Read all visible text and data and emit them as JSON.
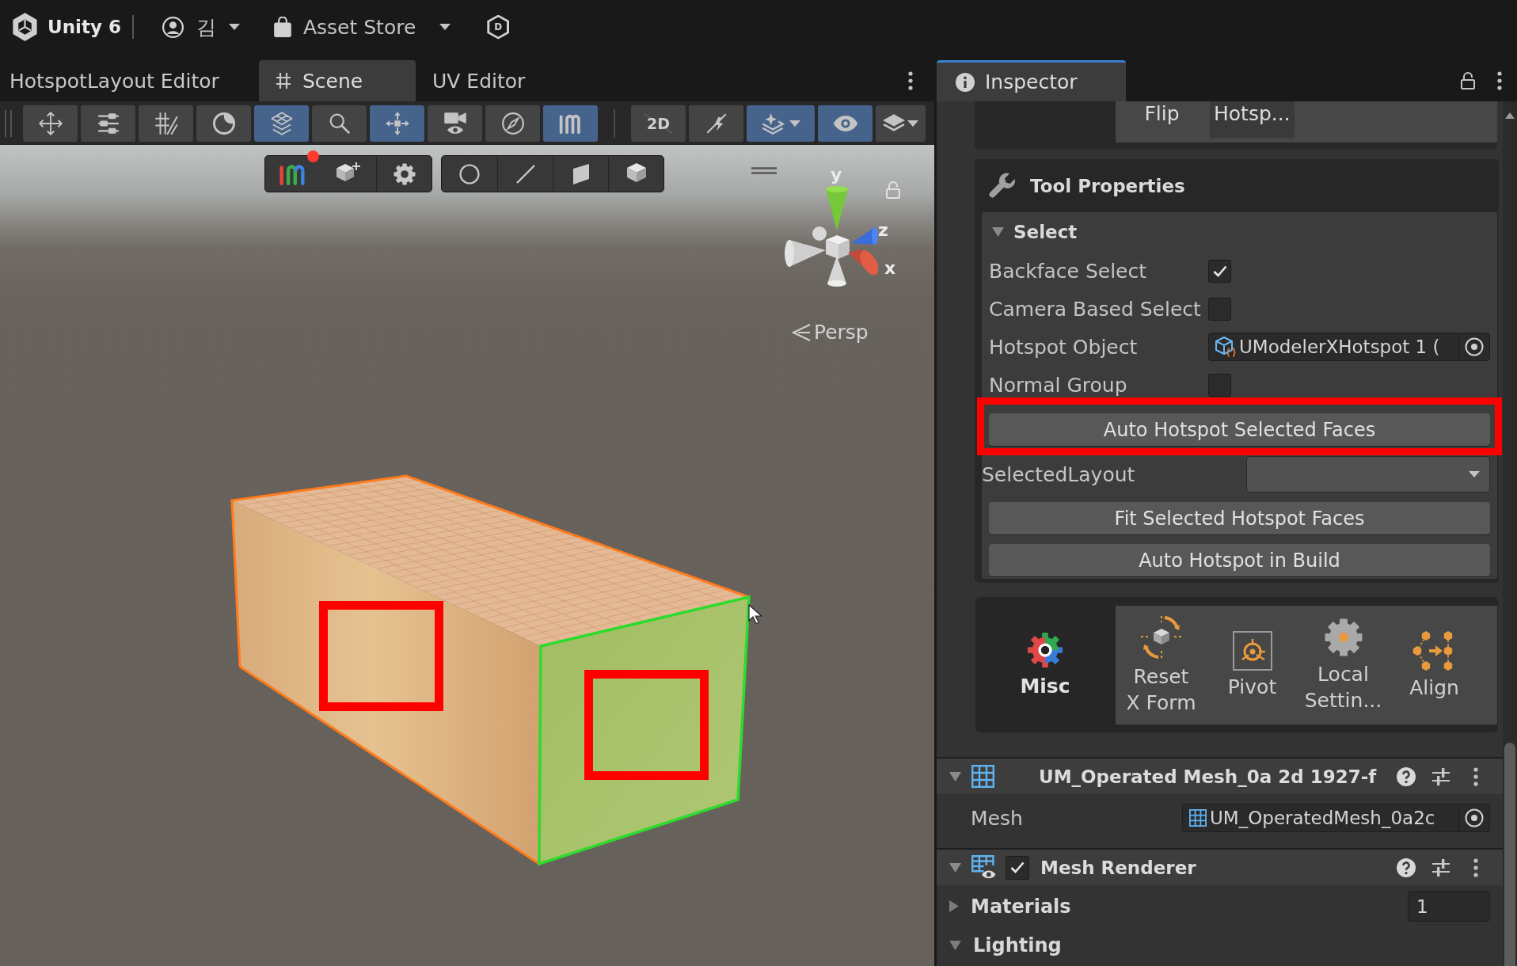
{
  "title_bar": {
    "app_name": "Unity 6",
    "account": "김",
    "store": "Asset Store",
    "badge": "D"
  },
  "scene_panel": {
    "tabs": [
      {
        "kind": "editor",
        "label": "HotspotLayout Editor",
        "selected": false
      },
      {
        "kind": "scene",
        "label": "Scene",
        "selected": true
      },
      {
        "kind": "editor",
        "label": "UV Editor",
        "selected": false
      }
    ],
    "toolbar": [
      {
        "on": false
      },
      {
        "on": false
      },
      {
        "on": false
      },
      {
        "on": false
      },
      {
        "on": true
      },
      {
        "on": false
      },
      {
        "on": true
      },
      {
        "on": false
      },
      {
        "on": false
      },
      {
        "on": true
      },
      {
        "on": false,
        "label": "2D"
      },
      {
        "on": false
      },
      {
        "on": true
      },
      {
        "on": true
      },
      {
        "on": false
      }
    ],
    "overlay_toolbar": [
      {
        "tools": [
          {
            "badge": true
          },
          {
            "badge": false
          },
          {
            "badge": false
          }
        ]
      },
      {
        "tools": [
          {
            "badge": false
          },
          {
            "badge": false
          },
          {
            "badge": false
          },
          {
            "badge": false
          }
        ]
      }
    ],
    "gizmo": {
      "axes": [
        "y",
        "z",
        "x"
      ],
      "projection": "Persp"
    }
  },
  "inspector": {
    "tab": {
      "label": "Inspector",
      "selected": true
    },
    "tool_tabs": [
      {
        "label": "Flip",
        "selected": false
      },
      {
        "label": "Hotsp...",
        "selected": true
      }
    ],
    "tool_properties": {
      "title": "Tool Properties",
      "section": {
        "label": "Select",
        "expanded": true
      },
      "fields": [
        {
          "kind": "checkbox",
          "label": "Backface Select",
          "checked": true
        },
        {
          "kind": "checkbox",
          "label": "Camera Based Select",
          "checked": false
        },
        {
          "kind": "object",
          "label": "Hotspot Object",
          "value": "UModelerXHotspot 1 ("
        },
        {
          "kind": "checkbox",
          "label": "Normal Group",
          "checked": false
        },
        {
          "kind": "button",
          "label": "Auto Hotspot Selected Faces",
          "highlighted": true
        },
        {
          "kind": "dropdown",
          "label": "SelectedLayout"
        },
        {
          "kind": "button",
          "label": "Fit Selected Hotspot Faces",
          "highlighted": false
        },
        {
          "kind": "button",
          "label": "Auto Hotspot in Build",
          "highlighted": false
        }
      ]
    },
    "tool_palette": {
      "category": "Misc",
      "tools": [
        {
          "label": "Reset X Form"
        },
        {
          "label": "Pivot"
        },
        {
          "label": "Local Settin..."
        },
        {
          "label": "Align"
        }
      ]
    },
    "components": [
      {
        "kind": "mesh_filter",
        "title": "UM_Operated Mesh_0a 2d 1927-f",
        "expanded": true,
        "properties": [
          {
            "kind": "object",
            "label": "Mesh",
            "value": "UM_OperatedMesh_0a2c"
          }
        ]
      },
      {
        "kind": "mesh_renderer",
        "title": "Mesh Renderer",
        "expanded": true,
        "enabled": true,
        "properties": [
          {
            "kind": "foldout",
            "label": "Materials",
            "expanded": false,
            "value": "1"
          },
          {
            "kind": "foldout",
            "label": "Lighting",
            "expanded": true
          }
        ]
      }
    ]
  }
}
